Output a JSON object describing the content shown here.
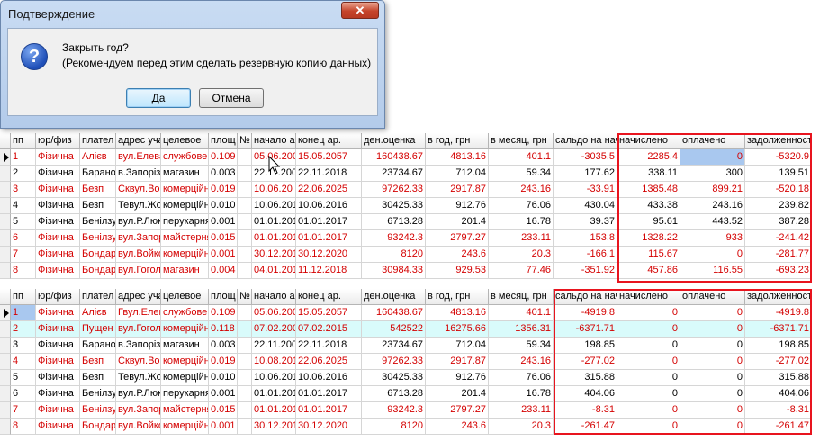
{
  "dialog": {
    "title": "Подтверждение",
    "close_glyph": "✕",
    "icon_glyph": "?",
    "question": "Закрыть год?",
    "hint": "(Рекомендуем перед этим сделать резервную копию данных)",
    "ok_label": "Да",
    "cancel_label": "Отмена"
  },
  "columns": [
    "пп",
    "юр/физ",
    "плател",
    "адрес уча",
    "целевое",
    "площ",
    "№",
    "начало ар",
    "конец ар.",
    "ден.оценка",
    "в год, грн",
    "в месяц, грн",
    "сальдо на нач",
    "начислено",
    "оплачено",
    "задолженность"
  ],
  "grid1": {
    "rows": [
      {
        "color": "red",
        "cells": [
          "1",
          "Фізична",
          "Алієв",
          "вул.Елева",
          "службове",
          "0.109",
          "",
          "05.06.200",
          "15.05.2057",
          "160438.67",
          "4813.16",
          "401.1",
          "-3035.5",
          "2285.4",
          "0",
          "-5320.9"
        ]
      },
      {
        "color": "blk",
        "cells": [
          "2",
          "Фізична",
          "Баранов",
          "в.Запорізь",
          "магазин",
          "0.003",
          "",
          "22.11.200",
          "22.11.2018",
          "23734.67",
          "712.04",
          "59.34",
          "177.62",
          "338.11",
          "300",
          "139.51"
        ]
      },
      {
        "color": "red",
        "cells": [
          "3",
          "Фізична",
          "Безп",
          "Сквул.Ворово",
          "комерційна",
          "0.019",
          "",
          "10.06.20",
          "22.06.2025",
          "97262.33",
          "2917.87",
          "243.16",
          "-33.91",
          "1385.48",
          "899.21",
          "-520.18"
        ]
      },
      {
        "color": "blk",
        "cells": [
          "4",
          "Фізична",
          "Безп",
          "Тевул.Жовт",
          "комерційна",
          "0.010",
          "",
          "10.06.201",
          "10.06.2016",
          "30425.33",
          "912.76",
          "76.06",
          "430.04",
          "433.38",
          "243.16",
          "239.82"
        ]
      },
      {
        "color": "blk",
        "cells": [
          "5",
          "Фізична",
          "Бенілзу",
          "вул.Р.Люкс",
          "перукарня",
          "0.001",
          "",
          "01.01.201",
          "01.01.2017",
          "6713.28",
          "201.4",
          "16.78",
          "39.37",
          "95.61",
          "443.52",
          "387.28"
        ]
      },
      {
        "color": "red",
        "cells": [
          "6",
          "Фізична",
          "Бенілзу",
          "вул.Запорі",
          "майстерня",
          "0.015",
          "",
          "01.01.201",
          "01.01.2017",
          "93242.3",
          "2797.27",
          "233.11",
          "153.8",
          "1328.22",
          "933",
          "-241.42"
        ]
      },
      {
        "color": "red",
        "cells": [
          "7",
          "Фізична",
          "Бондар",
          "вул.Войко",
          "комерційна",
          "0.001",
          "",
          "30.12.201",
          "30.12.2020",
          "8120",
          "243.6",
          "20.3",
          "-166.1",
          "115.67",
          "0",
          "-281.77"
        ]
      },
      {
        "color": "red",
        "cells": [
          "8",
          "Фізична",
          "Бондар",
          "вул.Гогол",
          "магазин",
          "0.004",
          "",
          "04.01.201",
          "11.12.2018",
          "30984.33",
          "929.53",
          "77.46",
          "-351.92",
          "457.86",
          "116.55",
          "-693.23"
        ]
      }
    ]
  },
  "grid2": {
    "rows": [
      {
        "color": "red",
        "cells": [
          "1",
          "Фізична",
          "Алієв",
          "Гвул.Елева",
          "службове",
          "0.109",
          "",
          "05.06.200",
          "15.05.2057",
          "160438.67",
          "4813.16",
          "401.1",
          "-4919.8",
          "0",
          "0",
          "-4919.8"
        ]
      },
      {
        "color": "red",
        "cells": [
          "2",
          "Фізична",
          "Пущен",
          "вул.Гогол",
          "комерційна",
          "0.118",
          "",
          "07.02.200",
          "07.02.2015",
          "542522",
          "16275.66",
          "1356.31",
          "-6371.71",
          "0",
          "0",
          "-6371.71"
        ]
      },
      {
        "color": "blk",
        "cells": [
          "3",
          "Фізична",
          "Баранов",
          "в.Запорізь",
          "магазин",
          "0.003",
          "",
          "22.11.200",
          "22.11.2018",
          "23734.67",
          "712.04",
          "59.34",
          "198.85",
          "0",
          "0",
          "198.85"
        ]
      },
      {
        "color": "red",
        "cells": [
          "4",
          "Фізична",
          "Безп",
          "Сквул.Ворово",
          "комерційна",
          "0.019",
          "",
          "10.08.201",
          "22.06.2025",
          "97262.33",
          "2917.87",
          "243.16",
          "-277.02",
          "0",
          "0",
          "-277.02"
        ]
      },
      {
        "color": "blk",
        "cells": [
          "5",
          "Фізична",
          "Безп",
          "Тевул.Жовт",
          "комерційна",
          "0.010",
          "",
          "10.06.201",
          "10.06.2016",
          "30425.33",
          "912.76",
          "76.06",
          "315.88",
          "0",
          "0",
          "315.88"
        ]
      },
      {
        "color": "blk",
        "cells": [
          "6",
          "Фізична",
          "Бенілзу",
          "вул.Р.Люкс",
          "перукарня",
          "0.001",
          "",
          "01.01.201",
          "01.01.2017",
          "6713.28",
          "201.4",
          "16.78",
          "404.06",
          "0",
          "0",
          "404.06"
        ]
      },
      {
        "color": "red",
        "cells": [
          "7",
          "Фізична",
          "Бенілзу",
          "вул.Запорі",
          "майстерня",
          "0.015",
          "",
          "01.01.201",
          "01.01.2017",
          "93242.3",
          "2797.27",
          "233.11",
          "-8.31",
          "0",
          "0",
          "-8.31"
        ]
      },
      {
        "color": "red",
        "cells": [
          "8",
          "Фізична",
          "Бондар",
          "вул.Войко",
          "комерційна",
          "0.001",
          "",
          "30.12.201",
          "30.12.2020",
          "8120",
          "243.6",
          "20.3",
          "-261.47",
          "0",
          "0",
          "-261.47"
        ]
      }
    ]
  },
  "colors": {
    "negative_row": "#d40000",
    "highlight_box": "#e8141e",
    "selected_cell": "#a9c8ef",
    "current_row": "#d9fbfb"
  }
}
